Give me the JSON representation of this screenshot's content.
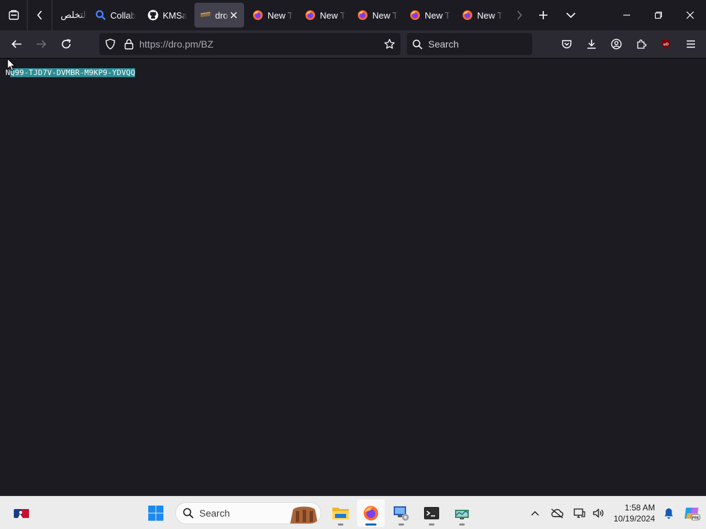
{
  "tabs": [
    {
      "title": "التخلص",
      "icon": "none"
    },
    {
      "title": "Collab",
      "icon": "magnifier-icon"
    },
    {
      "title": "KMSa",
      "icon": "github-icon"
    },
    {
      "title": "dro",
      "icon": "dropmark-icon",
      "active": true
    },
    {
      "title": "New T",
      "icon": "firefox-icon"
    },
    {
      "title": "New T",
      "icon": "firefox-icon"
    },
    {
      "title": "New T",
      "icon": "firefox-icon"
    },
    {
      "title": "New T",
      "icon": "firefox-icon"
    },
    {
      "title": "New T",
      "icon": "firefox-icon"
    }
  ],
  "nav": {
    "url": "https://dro.pm/BZ",
    "search_placeholder": "Search"
  },
  "content": {
    "prefix": "N",
    "selected_text": "Q99-TJD7V-DVMBR-M9KP9-YDVQQ"
  },
  "taskbar": {
    "search_label": "Search",
    "time": "1:58 AM",
    "date": "10/19/2024"
  },
  "colors": {
    "selection": "#2e8e95",
    "background": "#1c1b22",
    "toolbar": "#2b2a33",
    "taskbar": "#ececec"
  }
}
